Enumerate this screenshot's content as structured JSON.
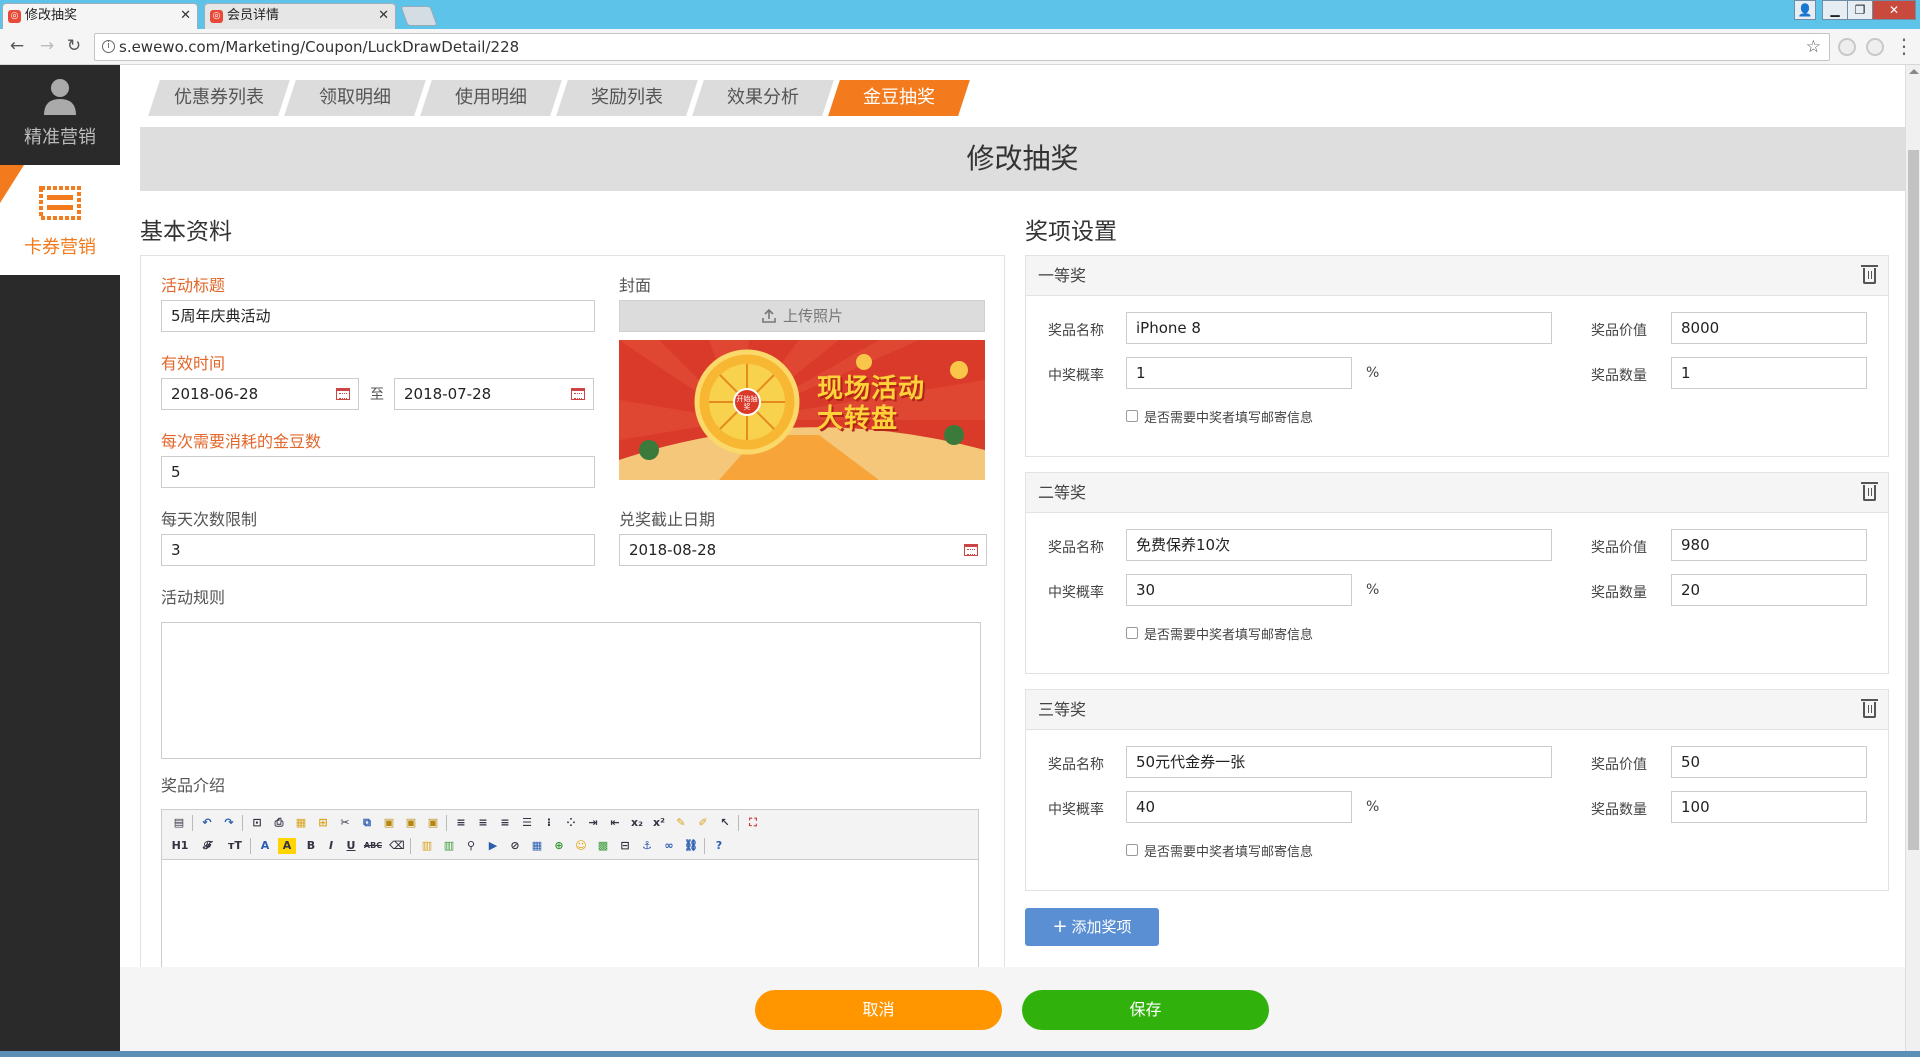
{
  "browser": {
    "tabs": [
      {
        "title": "修改抽奖",
        "active": true
      },
      {
        "title": "会员详情",
        "active": false
      }
    ],
    "url": "s.ewewo.com/Marketing/Coupon/LuckDrawDetail/228"
  },
  "sidebar": {
    "items": [
      {
        "label": "精准营销",
        "icon": "user-icon",
        "active": false
      },
      {
        "label": "卡券营销",
        "icon": "ticket-icon",
        "active": true
      }
    ]
  },
  "nav_tabs": [
    {
      "label": "优惠券列表",
      "active": false
    },
    {
      "label": "领取明细",
      "active": false
    },
    {
      "label": "使用明细",
      "active": false
    },
    {
      "label": "奖励列表",
      "active": false
    },
    {
      "label": "效果分析",
      "active": false
    },
    {
      "label": "金豆抽奖",
      "active": true
    }
  ],
  "page_title": "修改抽奖",
  "basic": {
    "section_title": "基本资料",
    "activity_title_label": "活动标题",
    "activity_title_value": "5周年庆典活动",
    "valid_time_label": "有效时间",
    "start_date": "2018-06-28",
    "to_label": "至",
    "end_date": "2018-07-28",
    "beans_label": "每次需要消耗的金豆数",
    "beans_value": "5",
    "daily_limit_label": "每天次数限制",
    "daily_limit_value": "3",
    "cover_label": "封面",
    "upload_label": "上传照片",
    "cover_text_line1": "现场活动",
    "cover_text_line2": "大转盘",
    "wheel_center_text": "开始抽奖",
    "deadline_label": "兑奖截止日期",
    "deadline_value": "2018-08-28",
    "rules_label": "活动规则",
    "rules_value": "",
    "intro_label": "奖品介绍"
  },
  "editor": {
    "row1": [
      "source",
      "undo",
      "redo",
      "preview",
      "print",
      "template",
      "code",
      "cut",
      "copy",
      "paste",
      "paste-text",
      "paste-word",
      "align-left",
      "align-center",
      "align-right",
      "justify",
      "ordered-list",
      "unordered-list",
      "indent",
      "outdent",
      "subscript",
      "superscript",
      "clear-format",
      "select-all",
      "fullscreen"
    ],
    "row2_labels": [
      "H1",
      "𝓕",
      "тT",
      "A",
      "A",
      "B",
      "I",
      "U",
      "ABC",
      "⌫"
    ]
  },
  "prizes": {
    "section_title": "奖项设置",
    "name_label": "奖品名称",
    "value_label": "奖品价值",
    "prob_label": "中奖概率",
    "qty_label": "奖品数量",
    "percent": "%",
    "mail_label": "是否需要中奖者填写邮寄信息",
    "items": [
      {
        "title": "一等奖",
        "name": "iPhone 8",
        "value": "8000",
        "prob": "1",
        "qty": "1",
        "mail": false
      },
      {
        "title": "二等奖",
        "name": "免费保养10次",
        "value": "980",
        "prob": "30",
        "qty": "20",
        "mail": false
      },
      {
        "title": "三等奖",
        "name": "50元代金券一张",
        "value": "50",
        "prob": "40",
        "qty": "100",
        "mail": false
      }
    ],
    "add_label": "添加奖项"
  },
  "footer": {
    "cancel_label": "取消",
    "save_label": "保存"
  },
  "colors": {
    "accent": "#f37b1d",
    "cancel": "#ff9600",
    "save": "#31b10c",
    "add": "#5b8fd4",
    "required_label": "#e2672b"
  }
}
